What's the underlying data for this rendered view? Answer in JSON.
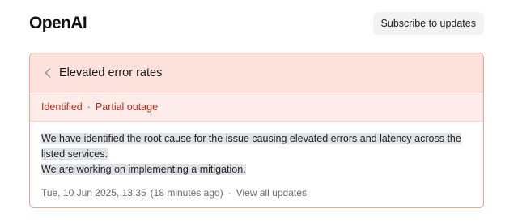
{
  "header": {
    "logo": "OpenAI",
    "subscribe_label": "Subscribe to updates"
  },
  "incident": {
    "title": "Elevated error rates",
    "status": "Identified",
    "separator": "·",
    "impact": "Partial outage",
    "message_line1": "We have identified the root cause for the issue causing elevated errors and latency across the",
    "message_line2": "listed services.",
    "message_line3": "We are working on implementing a mitigation.",
    "timestamp": "Tue, 10 Jun 2025, 13:35",
    "relative_time": "(18 minutes ago)",
    "meta_separator": "·",
    "view_all_label": "View all updates"
  },
  "colors": {
    "accent_red": "#b32d16",
    "card_border": "#f1a396",
    "title_bg": "#fde1dc",
    "status_bg": "#fdecea"
  },
  "icons": {
    "back": "chevron-left-icon"
  }
}
